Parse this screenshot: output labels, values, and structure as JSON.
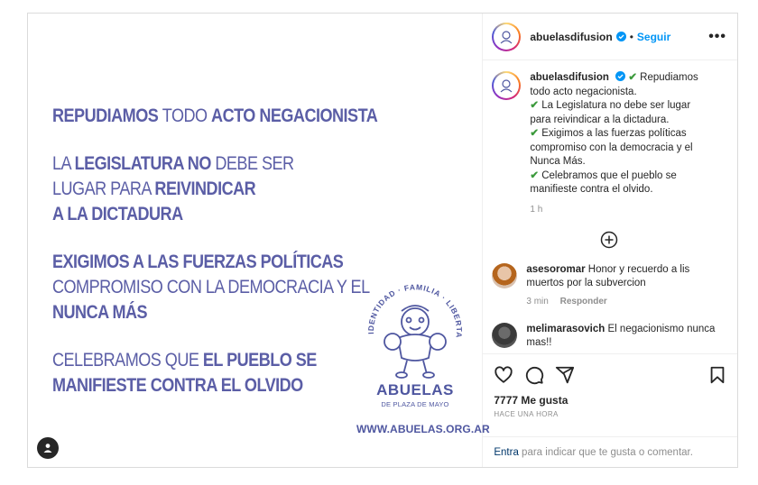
{
  "post": {
    "poster": {
      "lines": [
        [
          {
            "t": "REPUDIAMOS ",
            "b": true
          },
          {
            "t": "TODO ",
            "b": false
          },
          {
            "t": "ACTO NEGACIONISTA",
            "b": true
          }
        ],
        [
          {
            "t": "LA ",
            "b": false
          },
          {
            "t": "LEGISLATURA NO ",
            "b": true
          },
          {
            "t": "DEBE SER",
            "b": false
          }
        ],
        [
          {
            "t": "LUGAR PARA ",
            "b": false
          },
          {
            "t": "REIVINDICAR",
            "b": true
          }
        ],
        [
          {
            "t": "A LA DICTADURA",
            "b": true
          }
        ],
        [
          {
            "t": "EXIGIMOS A LAS FUERZAS POLÍTICAS",
            "b": true
          }
        ],
        [
          {
            "t": "COMPROMISO CON LA DEMOCRACIA Y EL",
            "b": false
          }
        ],
        [
          {
            "t": "NUNCA MÁS",
            "b": true
          }
        ],
        [
          {
            "t": "CELEBRAMOS QUE ",
            "b": false
          },
          {
            "t": "EL PUEBLO SE",
            "b": true
          }
        ],
        [
          {
            "t": "MANIFIESTE CONTRA EL OLVIDO",
            "b": true
          }
        ]
      ],
      "logo": {
        "arc_words": [
          "IDENTIDAD",
          "FAMILIA",
          "LIBERTAD"
        ],
        "name": "ABUELAS",
        "subtitle": "DE PLAZA DE MAYO",
        "website": "WWW.ABUELAS.ORG.AR"
      }
    },
    "header": {
      "username": "abuelasdifusion",
      "separator": "•",
      "follow_label": "Seguir",
      "more_label": "•••"
    },
    "caption": {
      "username": "abuelasdifusion",
      "check": "✔",
      "items": [
        "Repudiamos todo acto negacionista.",
        "La Legislatura no debe ser lugar para reivindicar a la dictadura.",
        "Exigimos a las fuerzas políticas compromiso con la democracia y el Nunca Más.",
        "Celebramos que el pueblo se manifieste contra el olvido."
      ],
      "time": "1 h"
    },
    "comments": [
      {
        "username": "asesoromar",
        "text": "Honor y recuerdo a lis muertos por la subvercion",
        "time": "3 min",
        "reply_label": "Responder"
      },
      {
        "username": "melimarasovich",
        "text": "El negacionismo nunca mas!!"
      }
    ],
    "likes": "7777 Me gusta",
    "posted_ago": "HACE UNA HORA",
    "add_comment": {
      "link": "Entra",
      "rest": " para indicar que te gusta o comentar."
    }
  },
  "colors": {
    "poster_purple": "#5b5ea6",
    "link_blue": "#0095f6",
    "check_green": "#3c9a3c"
  }
}
